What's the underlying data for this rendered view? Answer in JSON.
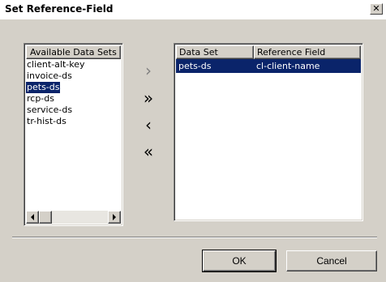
{
  "window": {
    "title": "Set Reference-Field",
    "close_glyph": "✕"
  },
  "available_list": {
    "header": "Available Data Sets",
    "items": [
      "client-alt-key",
      "invoice-ds",
      "pets-ds",
      "rcp-ds",
      "service-ds",
      "tr-hist-ds"
    ],
    "selected": "pets-ds"
  },
  "move_buttons": {
    "add_one": "›",
    "add_all": "»",
    "remove_one": "‹",
    "remove_all": "«"
  },
  "reference_grid": {
    "columns": [
      "Data Set",
      "Reference Field"
    ],
    "rows": [
      {
        "data_set": "pets-ds",
        "reference_field": "cl-client-name"
      }
    ]
  },
  "buttons": {
    "ok": "OK",
    "cancel": "Cancel"
  },
  "icons": {
    "scroll_left": "left-arrow-icon",
    "scroll_right": "right-arrow-icon"
  }
}
